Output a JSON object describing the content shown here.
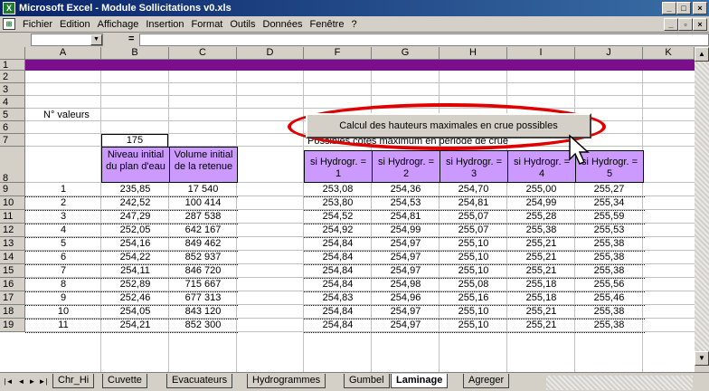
{
  "window": {
    "title": "Microsoft Excel - Module Sollicitations v0.xls",
    "app_icon": "X",
    "controls": [
      "_",
      "□",
      "×"
    ]
  },
  "menu": {
    "items": [
      {
        "label": "Fichier"
      },
      {
        "label": "Edition"
      },
      {
        "label": "Affichage"
      },
      {
        "label": "Insertion"
      },
      {
        "label": "Format"
      },
      {
        "label": "Outils"
      },
      {
        "label": "Données"
      },
      {
        "label": "Fenêtre"
      },
      {
        "label": "?"
      }
    ],
    "doc_controls": [
      "_",
      "▫",
      "×"
    ]
  },
  "formula_bar": {
    "name_box": "",
    "equals": "=",
    "content": ""
  },
  "columns": [
    "A",
    "B",
    "C",
    "D",
    "F",
    "G",
    "H",
    "I",
    "J",
    "K"
  ],
  "rows": [
    "1",
    "2",
    "3",
    "4",
    "5",
    "6",
    "7",
    "8",
    "9",
    "10",
    "11",
    "12",
    "13",
    "14",
    "15",
    "16",
    "17",
    "18",
    "19"
  ],
  "labels": {
    "nb_valeurs": "N° valeurs",
    "nb_valeurs_value": "175",
    "possibles": "Possibles cotes maximum en période de crue",
    "calc_button": "Calcul des hauteurs maximales en crue possibles"
  },
  "left_headers": [
    "Niveau initial du plan d'eau",
    "Volume initial de la retenue"
  ],
  "left_table": [
    [
      "1",
      "235,85",
      "17 540"
    ],
    [
      "2",
      "242,52",
      "100 414"
    ],
    [
      "3",
      "247,29",
      "287 538"
    ],
    [
      "4",
      "252,05",
      "642 167"
    ],
    [
      "5",
      "254,16",
      "849 462"
    ],
    [
      "6",
      "254,22",
      "852 937"
    ],
    [
      "7",
      "254,11",
      "846 720"
    ],
    [
      "8",
      "252,89",
      "715 667"
    ],
    [
      "9",
      "252,46",
      "677 313"
    ],
    [
      "10",
      "254,05",
      "843 120"
    ],
    [
      "11",
      "254,21",
      "852 300"
    ]
  ],
  "right_headers": [
    {
      "top": "si Hydrogr. =",
      "num": "1"
    },
    {
      "top": "si Hydrogr. =",
      "num": "2"
    },
    {
      "top": "si Hydrogr. =",
      "num": "3"
    },
    {
      "top": "si Hydrogr. =",
      "num": "4"
    },
    {
      "top": "si Hydrogr. =",
      "num": "5"
    }
  ],
  "right_table": [
    [
      "253,08",
      "254,36",
      "254,70",
      "255,00",
      "255,27"
    ],
    [
      "253,80",
      "254,53",
      "254,81",
      "254,99",
      "255,34"
    ],
    [
      "254,52",
      "254,81",
      "255,07",
      "255,28",
      "255,59"
    ],
    [
      "254,92",
      "254,99",
      "255,07",
      "255,38",
      "255,53"
    ],
    [
      "254,84",
      "254,97",
      "255,10",
      "255,21",
      "255,38"
    ],
    [
      "254,84",
      "254,97",
      "255,10",
      "255,21",
      "255,38"
    ],
    [
      "254,84",
      "254,97",
      "255,10",
      "255,21",
      "255,38"
    ],
    [
      "254,84",
      "254,98",
      "255,08",
      "255,18",
      "255,56"
    ],
    [
      "254,83",
      "254,96",
      "255,16",
      "255,18",
      "255,46"
    ],
    [
      "254,84",
      "254,97",
      "255,10",
      "255,21",
      "255,38"
    ],
    [
      "254,84",
      "254,97",
      "255,10",
      "255,21",
      "255,38"
    ]
  ],
  "sheet_tabs": [
    {
      "label": "Chr_Hi",
      "active": false
    },
    {
      "label": "Cuvette",
      "active": false
    },
    {
      "label": "Evacuateurs",
      "active": false
    },
    {
      "label": "Hydrogrammes",
      "active": false
    },
    {
      "label": "Gumbel",
      "active": false
    },
    {
      "label": "Laminage",
      "active": true
    },
    {
      "label": "Agreger",
      "active": false
    }
  ],
  "colors": {
    "band": "#7b0f8b",
    "header_fill": "#cc99ff",
    "highlight": "#e00000"
  }
}
